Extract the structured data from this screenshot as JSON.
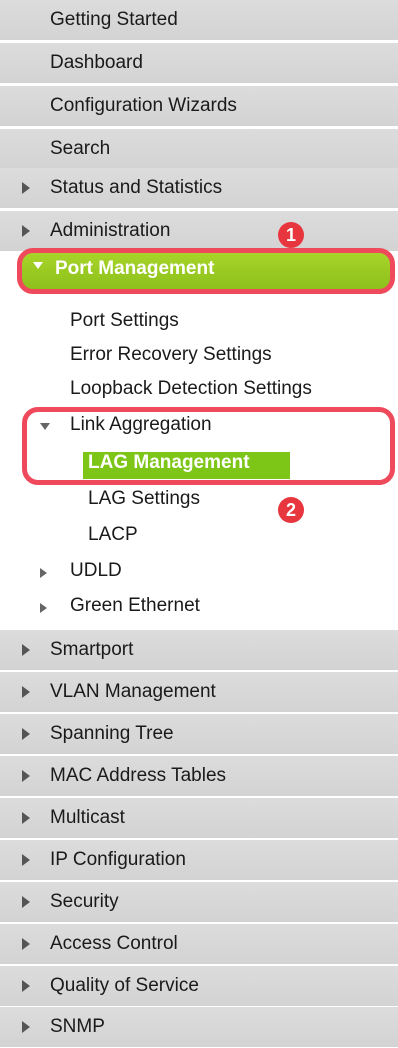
{
  "top_items": [
    "Getting Started",
    "Dashboard",
    "Configuration Wizards",
    "Search"
  ],
  "status_and_statistics": "Status and Statistics",
  "administration": "Administration",
  "port_management": {
    "label": "Port Management",
    "children": [
      "Port Settings",
      "Error Recovery Settings",
      "Loopback Detection Settings"
    ],
    "link_aggregation": {
      "label": "Link Aggregation",
      "children": [
        "LAG Management",
        "LAG Settings",
        "LACP"
      ]
    },
    "collapsed_children": [
      "UDLD",
      "Green Ethernet"
    ]
  },
  "bottom_items": [
    "Smartport",
    "VLAN Management",
    "Spanning Tree",
    "MAC Address Tables",
    "Multicast",
    "IP Configuration",
    "Security",
    "Access Control",
    "Quality of Service",
    "SNMP"
  ],
  "annotations": {
    "badge_1": "1",
    "badge_2": "2"
  },
  "colors": {
    "menu_bg": "#d6d6d6",
    "active_green": "#8cc11b",
    "annotation_red": "#ef4a5c"
  },
  "icons": {
    "collapsed": "triangle-right",
    "expanded": "triangle-down"
  }
}
